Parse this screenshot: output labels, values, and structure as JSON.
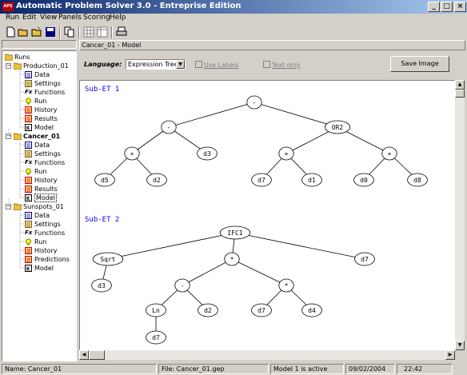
{
  "window": {
    "title": "Automatic Problem Solver 3.0 - Entreprise Edition",
    "app_icon_text": "APS",
    "minimize": "_",
    "maximize": "□",
    "close": "×"
  },
  "menu": [
    "Run",
    "Edit",
    "View",
    "Panels",
    "Scoring",
    "Help"
  ],
  "toolbar": {
    "icons": [
      "new-icon",
      "open-icon",
      "open-folder-icon",
      "save-icon",
      "copy-icon",
      "grid-icon",
      "table-icon",
      "print-icon"
    ]
  },
  "tree": {
    "root": "Runs",
    "runs": [
      {
        "name": "Production_01",
        "items": [
          "Data",
          "Settings",
          "Functions",
          "Run",
          "History",
          "Results",
          "Model"
        ]
      },
      {
        "name": "Cancer_01",
        "items": [
          "Data",
          "Settings",
          "Functions",
          "Run",
          "History",
          "Results",
          "Model"
        ]
      },
      {
        "name": "Sunspots_01",
        "items": [
          "Data",
          "Settings",
          "Functions",
          "Run",
          "History",
          "Predictions",
          "Model"
        ]
      }
    ],
    "functions_prefix": "Fx",
    "model_icon_letter": "K"
  },
  "panel": {
    "title": "Cancer_01 - Model",
    "language_label": "Language:",
    "language_value": "Expression Tree",
    "use_labels": "Use Labels",
    "text_only": "Text only",
    "save_image": "Save Image",
    "colors": {
      "accent_link": "#0000ff"
    }
  },
  "expression_trees": [
    {
      "label": "Sub-ET 1",
      "nodes": {
        "root": "-",
        "l": "-",
        "r": "OR2",
        "ll": "+",
        "lr": "d3",
        "rl": "+",
        "rr": "+",
        "lll": "d5",
        "llr": "d2",
        "rll": "d7",
        "rlr": "d1",
        "rrl": "d0",
        "rrr": "d8"
      }
    },
    {
      "label": "Sub-ET 2",
      "nodes": {
        "root": "IFC1",
        "a": "Sqrt",
        "b": "*",
        "c": "d7",
        "a1": "d3",
        "b1": "-",
        "b2": "*",
        "b11": "Ln",
        "b12": "d2",
        "b21": "d7",
        "b22": "d4",
        "b111": "d7"
      }
    }
  ],
  "status": {
    "name": "Name: Cancer_01",
    "file": "File: Cancer_01.gep",
    "model": "Model 1 is active",
    "date": "09/02/2004",
    "time": "22:42"
  }
}
